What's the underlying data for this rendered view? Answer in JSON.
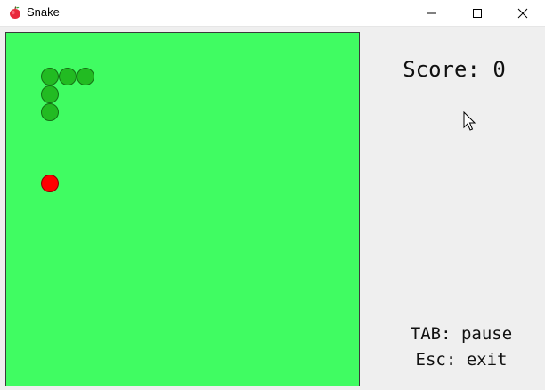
{
  "window": {
    "title": "Snake",
    "icon": "apple-icon",
    "controls": [
      "minimize-icon",
      "maximize-icon",
      "close-icon"
    ]
  },
  "game": {
    "board": {
      "color": "#40fc62",
      "border": "#3a3a3a"
    },
    "snake": {
      "color": "#22bb22",
      "segments": [
        {
          "col": 2,
          "row": 2
        },
        {
          "col": 3,
          "row": 2
        },
        {
          "col": 4,
          "row": 2
        },
        {
          "col": 2,
          "row": 3
        },
        {
          "col": 2,
          "row": 4
        }
      ]
    },
    "apple": {
      "color": "#ff0000",
      "col": 2,
      "row": 8
    }
  },
  "score": {
    "text": "Score: 0",
    "value": 0
  },
  "hints": {
    "pause": "TAB: pause",
    "exit": "Esc: exit"
  }
}
